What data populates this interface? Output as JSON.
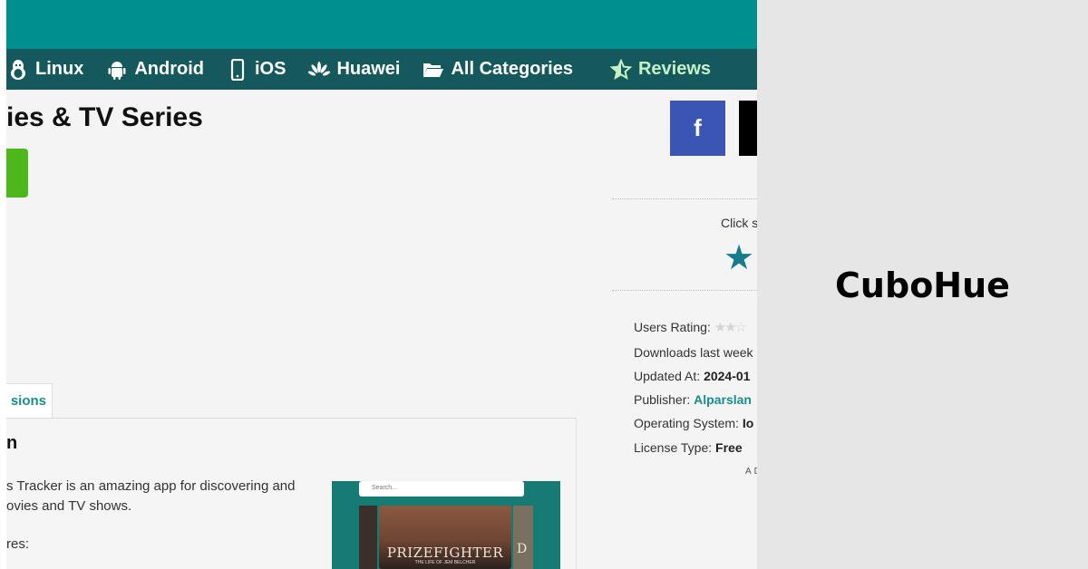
{
  "nav": {
    "items": [
      {
        "label": "Linux",
        "icon": "linux-penguin-icon"
      },
      {
        "label": "Android",
        "icon": "android-icon"
      },
      {
        "label": "iOS",
        "icon": "phone-icon"
      },
      {
        "label": "Huawei",
        "icon": "huawei-icon"
      },
      {
        "label": "All Categories",
        "icon": "folder-open-icon"
      },
      {
        "label": "Reviews",
        "icon": "star-half-icon"
      }
    ]
  },
  "page": {
    "title": "ies & TV Series",
    "tab_label": "sions",
    "section_heading": "n",
    "description_line1": "s Tracker is an amazing app for discovering and",
    "description_line2": "ovies and TV shows.",
    "features_label": "res:"
  },
  "screenshot": {
    "search_placeholder": "Search...",
    "poster_title": "PRIZEFIGHTER",
    "poster_subtitle": "THE LIFE OF JEM BELCHER",
    "poster_right_letter": "D"
  },
  "share": {
    "facebook_label": "f"
  },
  "rating": {
    "click_text": "Click s",
    "star": "★"
  },
  "info": {
    "users_rating_label": "Users Rating:",
    "users_rating_stars": "★★☆",
    "downloads_label": "Downloads last week",
    "updated_label": "Updated At:",
    "updated_value": "2024-01",
    "publisher_label": "Publisher:",
    "publisher_value": "Alparslan",
    "os_label": "Operating System:",
    "os_value": "Io",
    "license_label": "License Type:",
    "license_value": "Free",
    "ad_label": "AD"
  },
  "brand": {
    "name": "CuboHue"
  },
  "colors": {
    "topbar": "#008f8f",
    "navbar": "#15595c",
    "accent_teal": "#1a8c8c",
    "green_button": "#4cb81c",
    "facebook": "#3b55b5"
  }
}
